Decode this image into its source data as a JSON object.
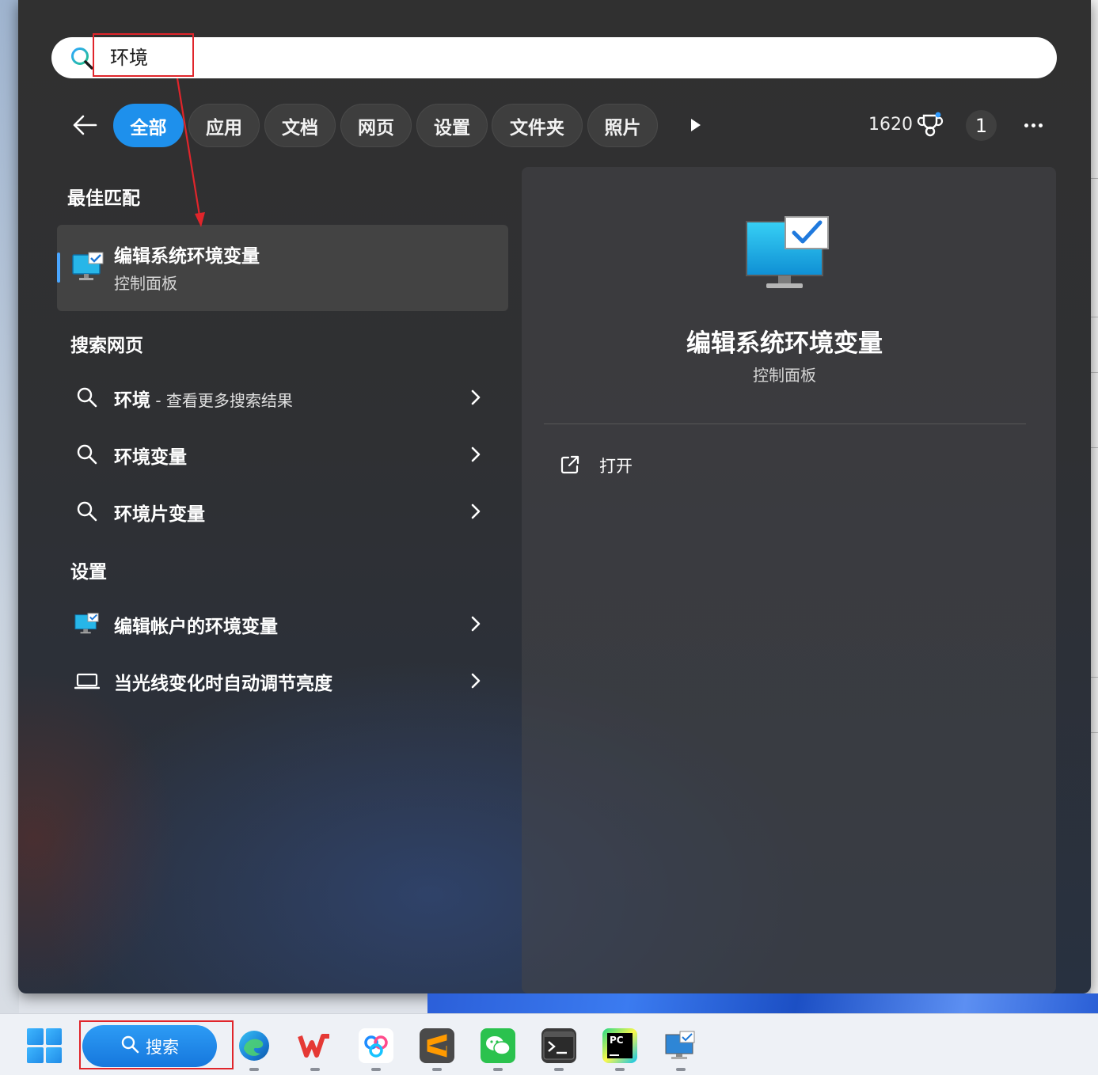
{
  "search": {
    "value": "环境"
  },
  "filters": {
    "tabs": [
      {
        "label": "全部",
        "active": true
      },
      {
        "label": "应用",
        "active": false
      },
      {
        "label": "文档",
        "active": false
      },
      {
        "label": "网页",
        "active": false
      },
      {
        "label": "设置",
        "active": false
      },
      {
        "label": "文件夹",
        "active": false
      },
      {
        "label": "照片",
        "active": false
      }
    ],
    "rewards_points": "1620",
    "badge_count": "1"
  },
  "best_match": {
    "heading": "最佳匹配",
    "title": "编辑系统环境变量",
    "subtitle": "控制面板"
  },
  "web_search": {
    "heading": "搜索网页",
    "items": [
      {
        "label": "环境",
        "minor": " - 查看更多搜索结果"
      },
      {
        "label": "环境变量"
      },
      {
        "label": "环境片变量"
      }
    ]
  },
  "settings": {
    "heading": "设置",
    "items": [
      {
        "label": "编辑帐户的环境变量",
        "icon": "monitor-check-icon"
      },
      {
        "label": "当光线变化时自动调节亮度",
        "icon": "laptop-icon"
      }
    ]
  },
  "preview": {
    "title": "编辑系统环境变量",
    "subtitle": "控制面板",
    "actions": [
      {
        "label": "打开",
        "icon": "open-external-icon"
      }
    ]
  },
  "taskbar": {
    "search_label": "搜索",
    "apps": [
      "edge-icon",
      "wps-icon",
      "baidu-netdisk-icon",
      "sublime-text-icon",
      "wechat-icon",
      "terminal-icon",
      "pycharm-icon",
      "remote-desktop-icon"
    ]
  },
  "colors": {
    "accent": "#1e90ec",
    "annotation": "#e0252b"
  }
}
